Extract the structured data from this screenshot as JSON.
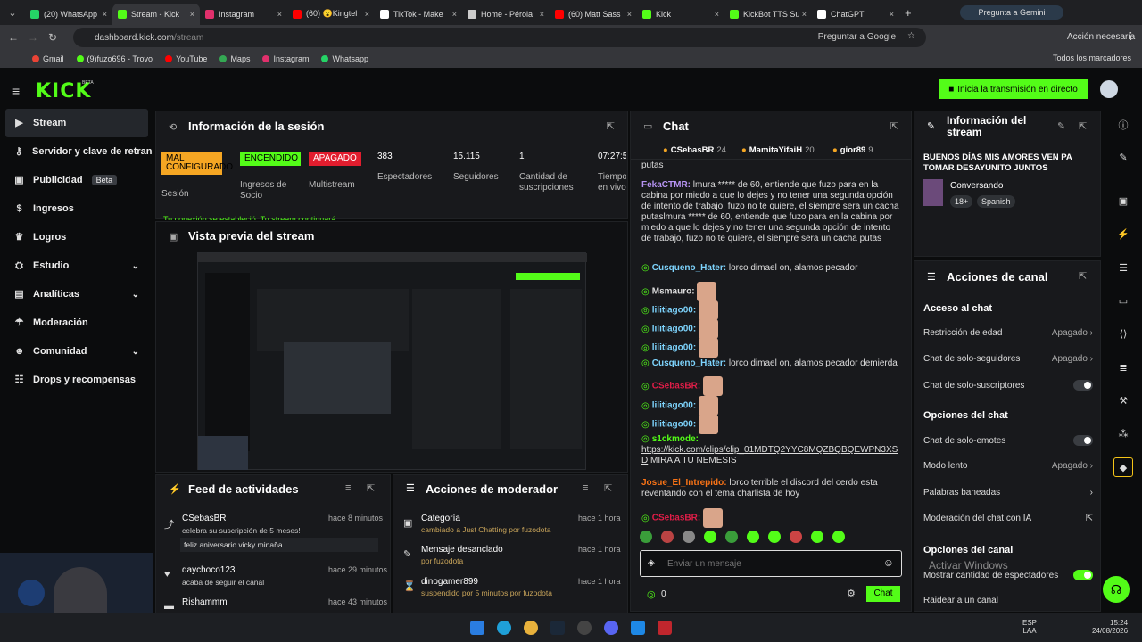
{
  "browser": {
    "tabs": [
      {
        "label": "(20) WhatsApp",
        "color": "#25d366"
      },
      {
        "label": "Stream - Kick",
        "color": "#53fc18"
      },
      {
        "label": "Instagram",
        "color": "#e1306c"
      },
      {
        "label": "(60) 😮Kingtel",
        "color": "#ff0000"
      },
      {
        "label": "TikTok - Make",
        "color": "#ffffff"
      },
      {
        "label": "Home - Pérola",
        "color": "#cccccc"
      },
      {
        "label": "(60) Matt Sass",
        "color": "#ff0000"
      },
      {
        "label": "Kick",
        "color": "#53fc18"
      },
      {
        "label": "KickBot TTS Su",
        "color": "#53fc18"
      },
      {
        "label": "ChatGPT",
        "color": "#ffffff"
      }
    ],
    "gemini_label": "Pregunta a Gemini",
    "url_host": "dashboard.kick.com",
    "url_path": "/stream",
    "ask_google": "Preguntar a Google",
    "action_needed": "Acción necesaria",
    "bookmarks": [
      "Gmail",
      "(9)fuzo696 - Trovo",
      "YouTube",
      "Maps",
      "Instagram",
      "Whatsapp"
    ],
    "all_bookmarks": "Todos los marcadores"
  },
  "header": {
    "logo": "KICK",
    "logo_beta": "BETA",
    "go_live": "Inicia la transmisión en directo"
  },
  "sidebar": {
    "items": [
      {
        "label": "Stream"
      },
      {
        "label": "Servidor y clave de retransmisión"
      },
      {
        "label": "Publicidad",
        "badge": "Beta"
      },
      {
        "label": "Ingresos"
      },
      {
        "label": "Logros"
      },
      {
        "label": "Estudio"
      },
      {
        "label": "Analíticas"
      },
      {
        "label": "Moderación"
      },
      {
        "label": "Comunidad"
      },
      {
        "label": "Drops y recompensas"
      }
    ]
  },
  "session": {
    "title": "Información de la sesión",
    "stats": [
      {
        "value": "MAL CONFIGURADO",
        "label": "Sesión",
        "color": "#f5a623"
      },
      {
        "value": "ENCENDIDO",
        "label": "Ingresos de Socio",
        "color": "#53fc18"
      },
      {
        "value": "APAGADO",
        "label": "Multistream",
        "color": "#e11d2e"
      },
      {
        "value": "383",
        "label": "Espectadores"
      },
      {
        "value": "15.115",
        "label": "Seguidores"
      },
      {
        "value": "1",
        "label": "Cantidad de suscripciones"
      },
      {
        "value": "07:27:5",
        "label": "Tiempo en vivo"
      }
    ],
    "connection_note": "Tu conexión se estableció. Tu stream continuará"
  },
  "preview": {
    "title": "Vista previa del stream"
  },
  "activity": {
    "title": "Feed de actividades",
    "items": [
      {
        "user": "CSebasBR",
        "time": "hace 8 minutos",
        "text": "celebra su suscripción de 5 meses!",
        "quote": "feliz aniversario vicky minaña"
      },
      {
        "user": "daychoco123",
        "time": "hace 29 minutos",
        "text": "acaba de seguir el canal"
      },
      {
        "user": "Rishammm",
        "time": "hace 43 minutos"
      }
    ]
  },
  "modactions": {
    "title": "Acciones de moderador",
    "items": [
      {
        "label": "Categoría",
        "time": "hace 1 hora",
        "sub": "cambiado a Just Chatting por fuzodota"
      },
      {
        "label": "Mensaje desanclado",
        "time": "hace 1 hora",
        "sub": "por fuzodota"
      },
      {
        "label": "dinogamer899",
        "time": "hace 1 hora",
        "sub": "suspendido por 5 minutos por fuzodota"
      }
    ]
  },
  "chat": {
    "title": "Chat",
    "top_gifters": [
      {
        "name": "CSebasBR",
        "count": "24"
      },
      {
        "name": "MamitaYifaiH",
        "count": "20"
      },
      {
        "name": "gior89",
        "count": "9"
      }
    ],
    "messages": [
      {
        "user": "",
        "text": "putas",
        "color": "#ddd"
      },
      {
        "user": "FekaCTMR:",
        "text": "lmura ***** de 60, entiende que fuzo para en la cabina por miedo a que lo dejes y no tener una segunda opción de intento de trabajo, fuzo no te quiere, el siempre sera un cacha putaslmura ***** de 60, entiende que fuzo para en la cabina por miedo a que lo dejes y no tener una segunda opción de intento de trabajo, fuzo no te quiere, el siempre sera un cacha putas",
        "color": "#b794f4"
      },
      {
        "user": "Cusqueno_Hater:",
        "text": "lorco dimael on, alamos pecador",
        "color": "#7dd3fc"
      },
      {
        "user": "Msmauro:",
        "text": "",
        "color": "#ddd"
      },
      {
        "user": "lilitiago00:",
        "text": "",
        "color": "#7dd3fc"
      },
      {
        "user": "lilitiago00:",
        "text": "",
        "color": "#7dd3fc"
      },
      {
        "user": "lilitiago00:",
        "text": "",
        "color": "#7dd3fc"
      },
      {
        "user": "Cusqueno_Hater:",
        "text": "lorco dimael on, alamos pecador demierda",
        "color": "#7dd3fc"
      },
      {
        "user": "CSebasBR:",
        "text": "",
        "color": "#e11d48"
      },
      {
        "user": "lilitiago00:",
        "text": "",
        "color": "#7dd3fc"
      },
      {
        "user": "lilitiago00:",
        "text": "",
        "color": "#7dd3fc"
      },
      {
        "user": "s1ckmode:",
        "text": "",
        "link": "https://kick.com/clips/clip_01MDTQ2YYC8MQZBQBQEWPN3XSD",
        "after": " MIRA A TU NEMESIS",
        "color": "#53fc18"
      },
      {
        "user": "Josue_El_Intrepido:",
        "text": "lorco terrible el discord del cerdo esta reventando con el tema charlista de hoy",
        "color": "#f97316"
      },
      {
        "user": "CSebasBR:",
        "text": "",
        "color": "#e11d48"
      }
    ],
    "input_placeholder": "Enviar un mensaje",
    "points": "0",
    "send_label": "Chat"
  },
  "stream_info": {
    "title": "Información del stream",
    "stream_title": "BUENOS DÍAS MIS AMORES VEN PA TOMAR DESAYUNITO JUNTOS",
    "category": "Conversando",
    "tags": [
      "18+",
      "Spanish"
    ]
  },
  "channel_actions": {
    "title": "Acciones de canal",
    "chat_access": "Acceso al chat",
    "age_restriction": {
      "label": "Restricción de edad",
      "value": "Apagado"
    },
    "followers_only": {
      "label": "Chat de solo-seguidores",
      "value": "Apagado"
    },
    "subs_only": {
      "label": "Chat de solo-suscriptores"
    },
    "chat_options": "Opciones del chat",
    "emotes_only": {
      "label": "Chat de solo-emotes"
    },
    "slow_mode": {
      "label": "Modo lento",
      "value": "Apagado"
    },
    "banned_words": "Palabras baneadas",
    "ai_moderation": "Moderación del chat con IA",
    "channel_options": "Opciones del canal",
    "show_viewers": "Mostrar cantidad de espectadores",
    "raid": "Raidear a un canal",
    "windows_watermark": "Activar Windows"
  },
  "taskbar": {
    "lang": "ESP",
    "lang2": "LAA",
    "time": "15:24",
    "date": "24/08/2026"
  }
}
